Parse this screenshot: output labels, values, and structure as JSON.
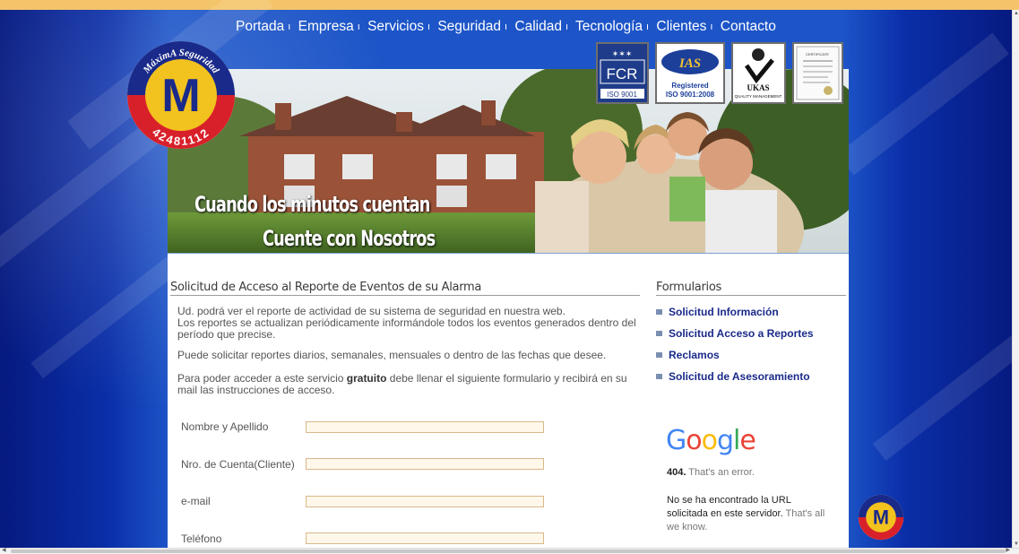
{
  "nav": {
    "items": [
      "Portada",
      "Empresa",
      "Servicios",
      "Seguridad",
      "Calidad",
      "Tecnología",
      "Clientes",
      "Contacto"
    ],
    "separator": "ı"
  },
  "logo": {
    "brand_text": "MáximA Seguridad",
    "phone": "42481112",
    "letter": "M"
  },
  "hero": {
    "tagline_line1": "Cuando los minutos cuentan",
    "tagline_line2": "Cuente con Nosotros"
  },
  "certifications": [
    {
      "name": "FCR",
      "caption": "ISO 9001"
    },
    {
      "name": "IAS",
      "caption_line1": "Registered",
      "caption_line2": "ISO 9001:2008"
    },
    {
      "name": "UKAS",
      "caption_line1": "UKAS",
      "caption_line2": "QUALITY MANAGEMENT"
    },
    {
      "name": "certificate",
      "caption": "CERTIFICATE"
    }
  ],
  "main": {
    "title": "Solicitud de Acceso al Reporte de Eventos de su Alarma",
    "para1_line1": "Ud. podrá ver el reporte de actividad de su sistema de seguridad en nuestra web.",
    "para1_line2": "Los reportes se actualizan periódicamente informándole todos los eventos generados dentro del",
    "para1_line3": "período que precise.",
    "para2": "Puede solicitar reportes diarios, semanales, mensuales o dentro de las fechas que desee.",
    "para3_pre": "Para poder acceder a este servicio ",
    "para3_bold": "gratuito",
    "para3_post": " debe llenar el siguiente formulario y recibirá en su",
    "para3_line2": "mail las instrucciones de acceso."
  },
  "form": {
    "fields": [
      {
        "label": "Nombre y Apellido",
        "value": ""
      },
      {
        "label": "Nro. de Cuenta(Cliente)",
        "value": ""
      },
      {
        "label": "e-mail",
        "value": ""
      },
      {
        "label": "Teléfono",
        "value": ""
      }
    ]
  },
  "sidebar": {
    "title": "Formularios",
    "links": [
      "Solicitud Información",
      "Solicitud Acceso a Reportes",
      "Reclamos",
      "Solicitud de Asesoramiento"
    ]
  },
  "google_error": {
    "logo_text": "Google",
    "code": "404.",
    "message": "That's an error.",
    "desc_dark": "No se ha encontrado la URL solicitada en este servidor.",
    "desc_light": "That's all we know."
  },
  "colors": {
    "top_bar": "#f4c46a",
    "link": "#1a2a8a",
    "input_bg": "#fff8ea",
    "input_border": "#d8b88a"
  }
}
